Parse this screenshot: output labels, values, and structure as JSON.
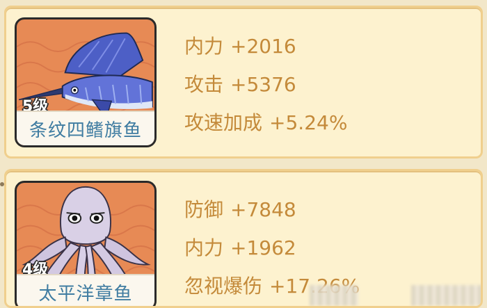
{
  "colors": {
    "card_bg": "#fdf2cf",
    "card_border": "#f0cf8d",
    "tile_bg": "#e78a55",
    "stat_text": "#c48a3a",
    "name_text": "#3f7ca1"
  },
  "cards": [
    {
      "level": "5级",
      "name": "条纹四鳍旗鱼",
      "icon": "marlin-icon",
      "stats": [
        {
          "label": "内力",
          "value": "+2016"
        },
        {
          "label": "攻击",
          "value": "+5376"
        },
        {
          "label": "攻速加成",
          "value": "+5.24%"
        }
      ]
    },
    {
      "level": "4级",
      "name": "太平洋章鱼",
      "icon": "octopus-icon",
      "stats": [
        {
          "label": "防御",
          "value": "+7848"
        },
        {
          "label": "内力",
          "value": "+1962"
        },
        {
          "label": "忽视爆伤",
          "value": "+17.26%"
        }
      ]
    }
  ]
}
